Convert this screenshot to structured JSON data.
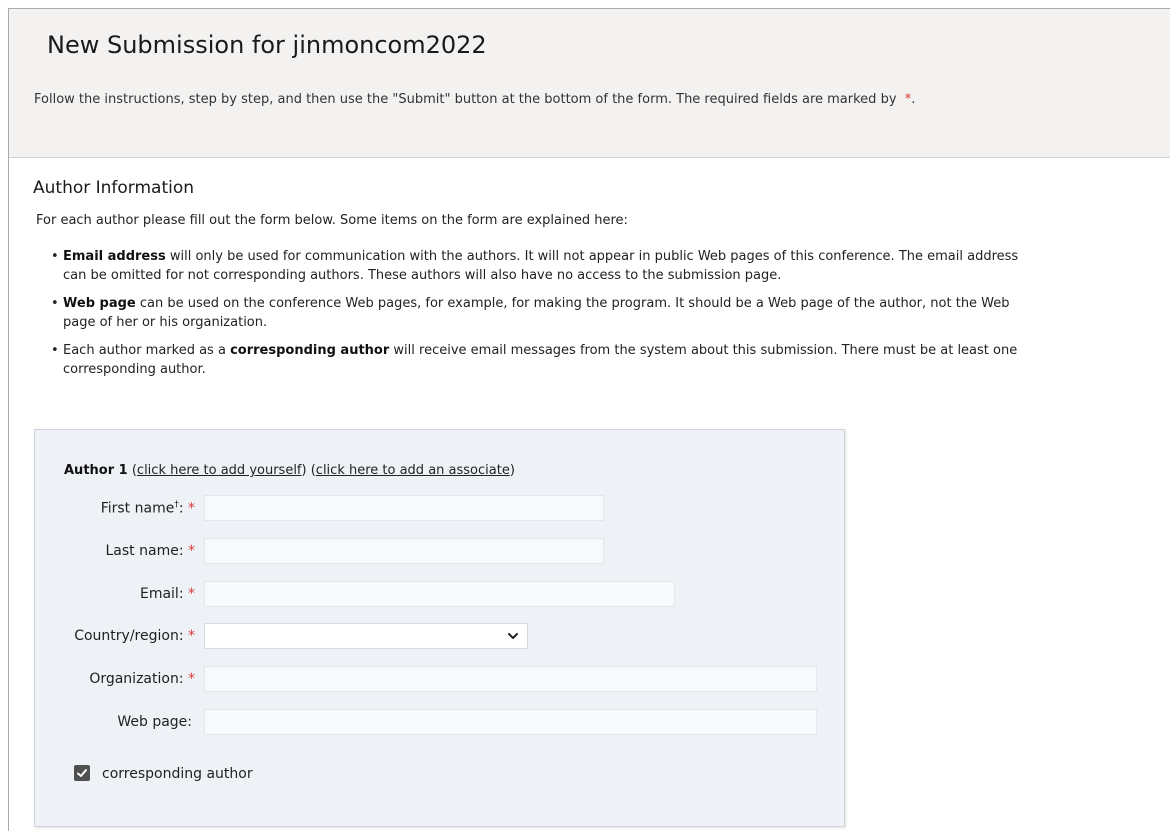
{
  "header": {
    "title": "New Submission for jinmoncom2022",
    "intro_text": "Follow the instructions, step by step, and then use the \"Submit\" button at the bottom of the form. The required fields are marked by",
    "required_marker": "*",
    "intro_end": "."
  },
  "author_info": {
    "title": "Author Information",
    "intro": "For each author please fill out the form below. Some items on the form are explained here:",
    "items": [
      {
        "bold": "Email address",
        "text": " will only be used for communication with the authors. It will not appear in public Web pages of this conference. The email address can be omitted for not corresponding authors. These authors will also have no access to the submission page."
      },
      {
        "bold": "Web page",
        "text": " can be used on the conference Web pages, for example, for making the program. It should be a Web page of the author, not the Web page of her or his organization."
      },
      {
        "prefix": "Each author marked as a ",
        "bold": "corresponding author",
        "text": " will receive email messages from the system about this submission. There must be at least one corresponding author."
      }
    ]
  },
  "author_form": {
    "heading": "Author 1",
    "add_yourself_link": "click here to add yourself",
    "add_associate_link": "click here to add an associate",
    "fields": {
      "first_name": {
        "label": "First name",
        "sup": "†",
        "suffix": ":",
        "required": "*",
        "value": ""
      },
      "last_name": {
        "label": "Last name:",
        "required": "*",
        "value": ""
      },
      "email": {
        "label": "Email:",
        "required": "*",
        "value": ""
      },
      "country": {
        "label": "Country/region:",
        "required": "*",
        "value": ""
      },
      "organization": {
        "label": "Organization:",
        "required": "*",
        "value": ""
      },
      "web_page": {
        "label": "Web page:",
        "value": ""
      }
    },
    "corresponding_author_label": "corresponding author",
    "corresponding_author_checked": true
  },
  "colors": {
    "required": "#d83b3b",
    "header_bg": "#f3f2f1",
    "form_bg": "#eef1f5"
  },
  "icons": {
    "select_arrow": "chevron-down-icon",
    "checkbox": "checkmark-icon"
  }
}
